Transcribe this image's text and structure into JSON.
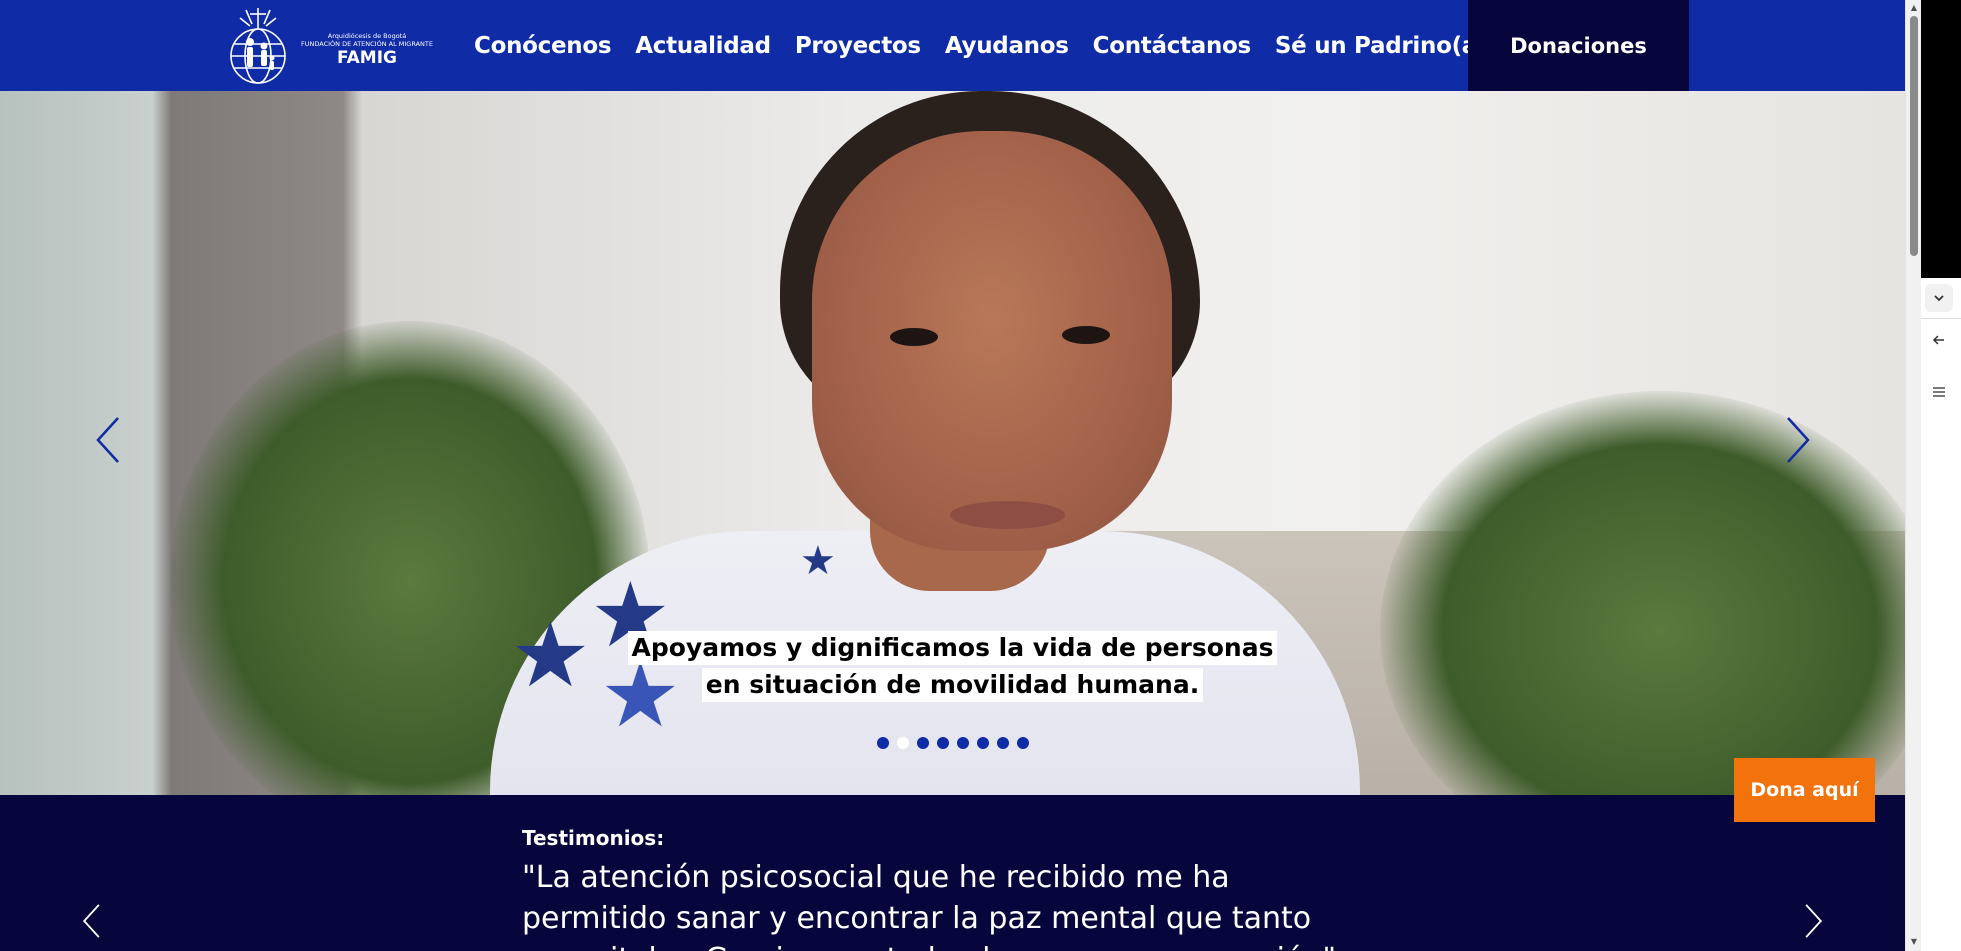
{
  "header": {
    "logo": {
      "line1": "Arquidiócesis de Bogotá",
      "line2": "FUNDACIÓN DE ATENCIÓN AL MIGRANTE",
      "name": "FAMIG"
    },
    "nav": [
      {
        "label": "Conócenos"
      },
      {
        "label": "Actualidad"
      },
      {
        "label": "Proyectos"
      },
      {
        "label": "Ayudanos"
      },
      {
        "label": "Contáctanos"
      },
      {
        "label": "Sé un Padrino(a)"
      }
    ],
    "donate_label": "Donaciones"
  },
  "hero": {
    "caption_line1": "Apoyamos y dignificamos la vida de personas",
    "caption_line2": "en situación de movilidad humana.",
    "dots_total": 8,
    "active_dot": 1
  },
  "floating": {
    "dona_label": "Dona aquí"
  },
  "testimonials": {
    "label": "Testimonios:",
    "quote": "\"La atención psicosocial que he recibido me ha permitido sanar y encontrar la paz mental que tanto necesitaba. Gracias por todo el apoyo y comprensión\""
  },
  "colors": {
    "header_blue": "#0f2ba6",
    "navy": "#06063c",
    "orange": "#f2720c"
  },
  "icons": {
    "prev": "chevron-left-icon",
    "next": "chevron-right-icon",
    "sidepanel_toggle": "chevron-down-icon",
    "sidepanel_back": "arrow-left-icon",
    "sidepanel_menu": "menu-icon"
  }
}
